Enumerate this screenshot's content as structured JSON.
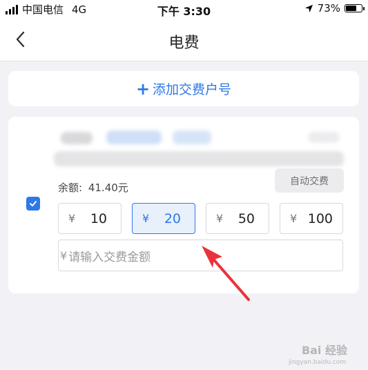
{
  "status_bar": {
    "carrier": "中国电信",
    "network": "4G",
    "time": "下午 3:30",
    "battery_percent": "73%",
    "battery_level": 0.73
  },
  "nav": {
    "title": "电费",
    "back_icon": "chevron-left-icon"
  },
  "add_account": {
    "icon": "plus-icon",
    "label": "添加交费户号"
  },
  "account": {
    "checked": true,
    "balance_label": "余额:",
    "balance_value": "41.40元",
    "auto_pay_label": "自动交费",
    "currency": "¥",
    "amounts": [
      "10",
      "20",
      "50",
      "100"
    ],
    "selected_amount": "20",
    "input_placeholder": "请输入交费金额"
  },
  "watermark": {
    "text": "Bai 经验",
    "sub": "jingyan.baidu.com"
  },
  "colors": {
    "accent": "#2f78e8",
    "arrow": "#e8343a"
  }
}
